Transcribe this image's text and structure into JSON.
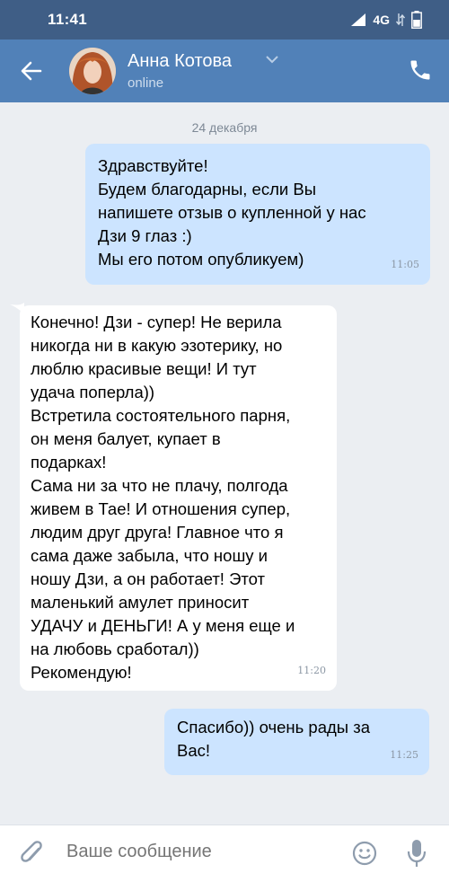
{
  "status_bar": {
    "time": "11:41",
    "network": "4G"
  },
  "header": {
    "contact_name": "Анна Котова",
    "status": "online"
  },
  "chat": {
    "date_separator": "24 декабря",
    "messages": [
      {
        "direction": "outgoing",
        "text": "Здравствуйте!\nБудем благодарны, если Вы\nнапишете отзыв о купленной у нас\nДзи 9 глаз :)\nМы его потом опубликуем)",
        "time": "11:05"
      },
      {
        "direction": "incoming",
        "text": "Конечно! Дзи - супер! Не верила\nникогда ни в какую эзотерику, но\nлюблю красивые вещи! И тут\nудача поперла))\nВстретила состоятельного парня,\nон меня балует, купает в\nподарках!\nСама ни за что не плачу, полгода\nживем в Тае! И отношения супер,\nлюдим друг друга! Главное что я\nсама даже забыла, что ношу и\nношу Дзи, а он работает! Этот\nмаленький амулет приносит\nУДАЧУ и ДЕНЬГИ! А у меня еще и\nна любовь сработал))\nРекомендую!",
        "time": "11:20"
      },
      {
        "direction": "outgoing",
        "text": "Спасибо)) очень рады за\nВас!",
        "time": "11:25"
      }
    ]
  },
  "composer": {
    "placeholder": "Ваше сообщение"
  },
  "colors": {
    "header": "#5181b8",
    "status_bar": "#3f5e86",
    "outgoing_bubble": "#cce4ff",
    "incoming_bubble": "#ffffff",
    "background": "#ebeef2"
  }
}
